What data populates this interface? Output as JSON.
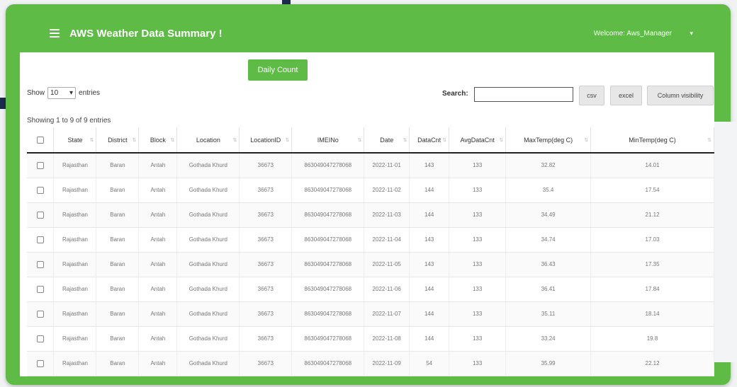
{
  "app": {
    "title": "AWS Weather Data Summary !",
    "welcome": "Welcome: Aws_Manager"
  },
  "toolbar": {
    "daily_count": "Daily Count",
    "show_prefix": "Show",
    "show_value": "10",
    "show_suffix": "entries",
    "search_label": "Search:",
    "search_value": "",
    "btn_csv": "csv",
    "btn_excel": "excel",
    "btn_colvis": "Column visibility"
  },
  "table": {
    "info": "Showing 1 to 9 of 9 entries",
    "columns": [
      "State",
      "District",
      "Block",
      "Location",
      "LocationID",
      "IMEINo",
      "Date",
      "DataCnt",
      "AvgDataCnt",
      "MaxTemp(deg C)",
      "MinTemp(deg C)"
    ],
    "rows": [
      [
        "Rajasthan",
        "Baran",
        "Antah",
        "Gothada Khurd",
        "36673",
        "863049047278068",
        "2022-11-01",
        "143",
        "133",
        "32.82",
        "14.01"
      ],
      [
        "Rajasthan",
        "Baran",
        "Antah",
        "Gothada Khurd",
        "36673",
        "863049047278068",
        "2022-11-02",
        "144",
        "133",
        "35.4",
        "17.54"
      ],
      [
        "Rajasthan",
        "Baran",
        "Antah",
        "Gothada Khurd",
        "36673",
        "863049047278068",
        "2022-11-03",
        "144",
        "133",
        "34.49",
        "21.12"
      ],
      [
        "Rajasthan",
        "Baran",
        "Antah",
        "Gothada Khurd",
        "36673",
        "863049047278068",
        "2022-11-04",
        "143",
        "133",
        "34.74",
        "17.03"
      ],
      [
        "Rajasthan",
        "Baran",
        "Antah",
        "Gothada Khurd",
        "36673",
        "863049047278068",
        "2022-11-05",
        "143",
        "133",
        "36.43",
        "17.35"
      ],
      [
        "Rajasthan",
        "Baran",
        "Antah",
        "Gothada Khurd",
        "36673",
        "863049047278068",
        "2022-11-06",
        "144",
        "133",
        "36.41",
        "17.84"
      ],
      [
        "Rajasthan",
        "Baran",
        "Antah",
        "Gothada Khurd",
        "36673",
        "863049047278068",
        "2022-11-07",
        "144",
        "133",
        "35.11",
        "18.14"
      ],
      [
        "Rajasthan",
        "Baran",
        "Antah",
        "Gothada Khurd",
        "36673",
        "863049047278068",
        "2022-11-08",
        "144",
        "133",
        "33.24",
        "19.8"
      ],
      [
        "Rajasthan",
        "Baran",
        "Antah",
        "Gothada Khurd",
        "36673",
        "863049047278068",
        "2022-11-09",
        "54",
        "133",
        "35.99",
        "22.12"
      ]
    ]
  },
  "colors": {
    "brand_green": "#5dbb46"
  },
  "icons": {
    "menu": "hamburger-icon",
    "dropdown": "chevron-down-icon",
    "sort": "sort-icon"
  }
}
